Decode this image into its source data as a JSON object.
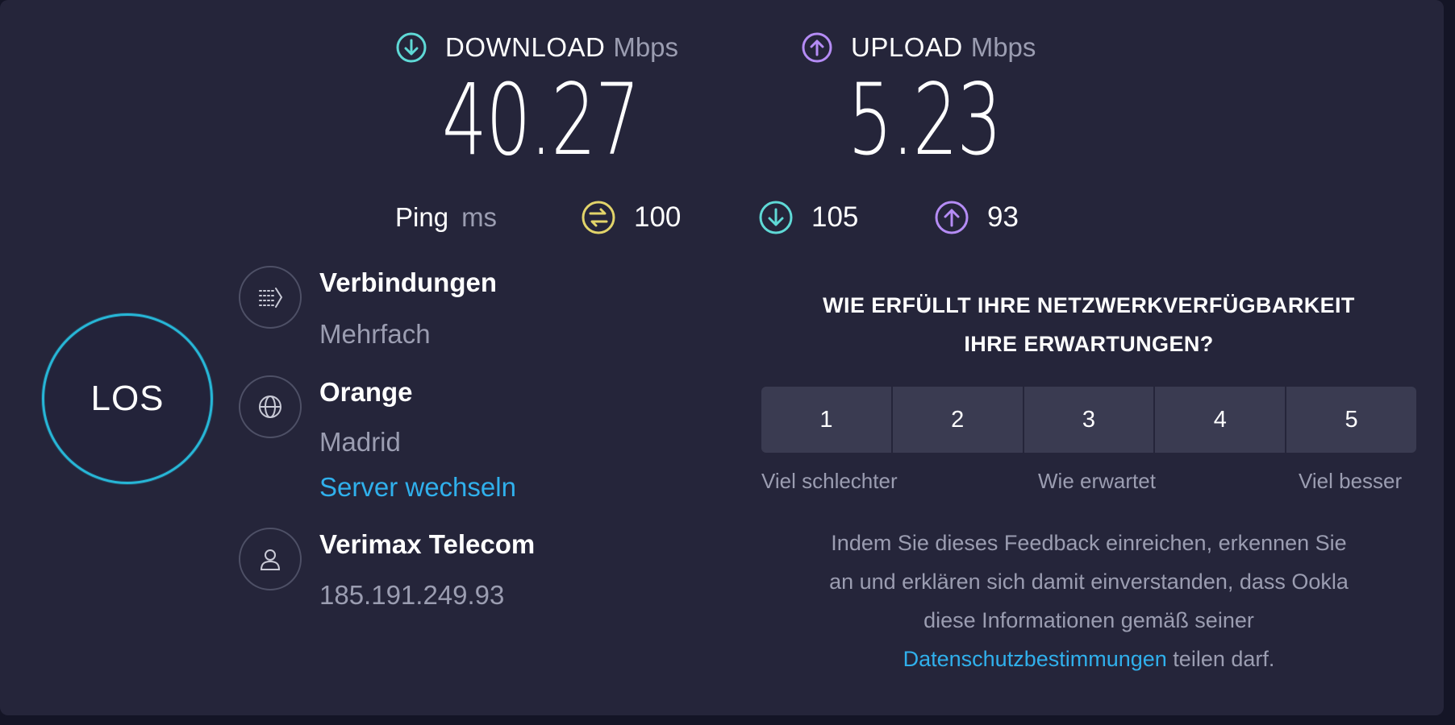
{
  "download": {
    "label": "DOWNLOAD",
    "unit": "Mbps",
    "value": "40.27",
    "icon": "download-arrow-icon",
    "color": "#5fd9d6"
  },
  "upload": {
    "label": "UPLOAD",
    "unit": "Mbps",
    "value": "5.23",
    "icon": "upload-arrow-icon",
    "color": "#b58cf5"
  },
  "ping": {
    "label": "Ping",
    "unit": "ms",
    "idle": {
      "value": "100",
      "icon": "ping-idle-icon",
      "color": "#e2d46a"
    },
    "download": {
      "value": "105",
      "icon": "download-arrow-icon",
      "color": "#5fd9d6"
    },
    "upload": {
      "value": "93",
      "icon": "upload-arrow-icon",
      "color": "#b58cf5"
    }
  },
  "go_button": {
    "label": "LOS",
    "accent": "#27b6d6"
  },
  "connections": {
    "title": "Verbindungen",
    "value": "Mehrfach",
    "icon": "connections-icon"
  },
  "server": {
    "name": "Orange",
    "location": "Madrid",
    "change_link": "Server wechseln",
    "icon": "globe-icon"
  },
  "provider": {
    "name": "Verimax Telecom",
    "ip": "185.191.249.93",
    "icon": "user-icon"
  },
  "feedback": {
    "question_line1": "WIE ERFÜLLT IHRE NETZWERKVERFÜGBARKEIT",
    "question_line2": "IHRE ERWARTUNGEN?",
    "options": [
      "1",
      "2",
      "3",
      "4",
      "5"
    ],
    "scale_low": "Viel schlechter",
    "scale_mid": "Wie erwartet",
    "scale_high": "Viel besser",
    "disclaimer_line1": "Indem Sie dieses Feedback einreichen, erkennen Sie",
    "disclaimer_line2": "an und erklären sich damit einverstanden, dass Ookla",
    "disclaimer_line3": "diese Informationen gemäß seiner",
    "privacy_link": "Datenschutzbestimmungen",
    "disclaimer_tail": " teilen darf."
  }
}
